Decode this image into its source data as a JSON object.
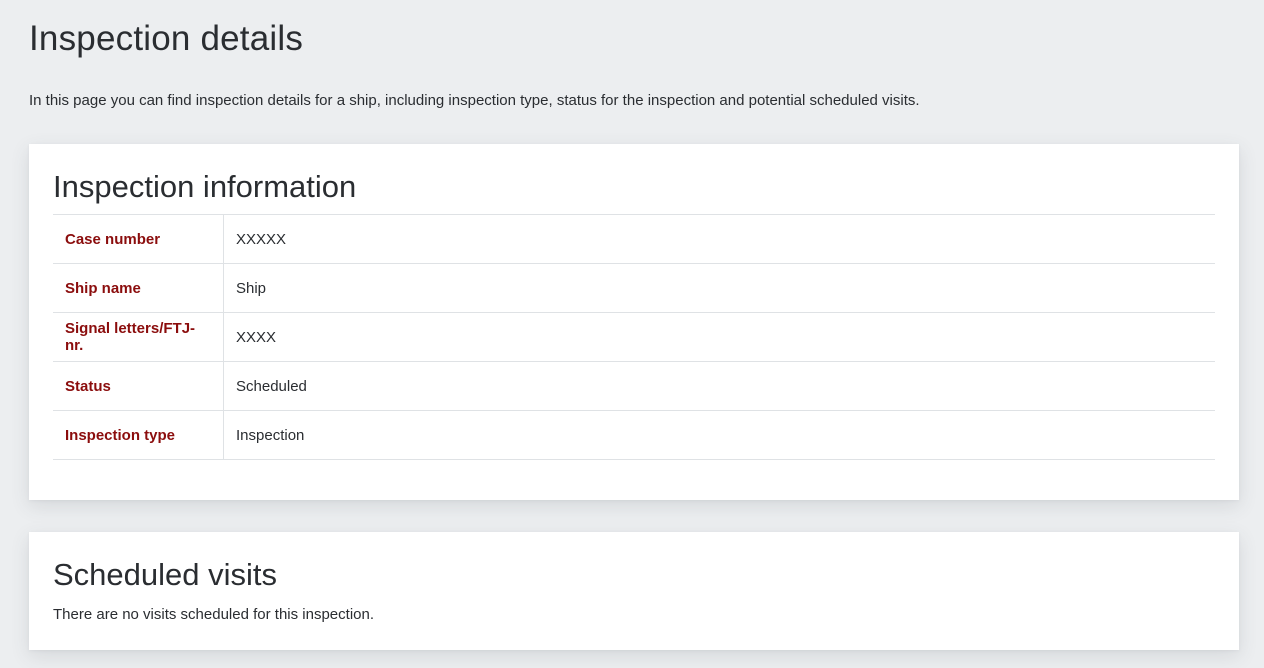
{
  "page": {
    "title": "Inspection details",
    "intro": "In this page you can find inspection details for a ship, including inspection type, status for the inspection and potential scheduled visits."
  },
  "inspection_info": {
    "title": "Inspection information",
    "rows": [
      {
        "label": "Case number",
        "value": "XXXXX"
      },
      {
        "label": "Ship name",
        "value": "Ship"
      },
      {
        "label": "Signal letters/FTJ-nr.",
        "value": "XXXX"
      },
      {
        "label": "Status",
        "value": "Scheduled"
      },
      {
        "label": "Inspection type",
        "value": "Inspection"
      }
    ]
  },
  "scheduled_visits": {
    "title": "Scheduled visits",
    "empty_message": "There are no visits scheduled for this inspection."
  },
  "colors": {
    "background": "#eceef0",
    "card": "#ffffff",
    "label": "#8b0d0d",
    "text": "#2a2d31",
    "divider": "#dfe2e5"
  }
}
